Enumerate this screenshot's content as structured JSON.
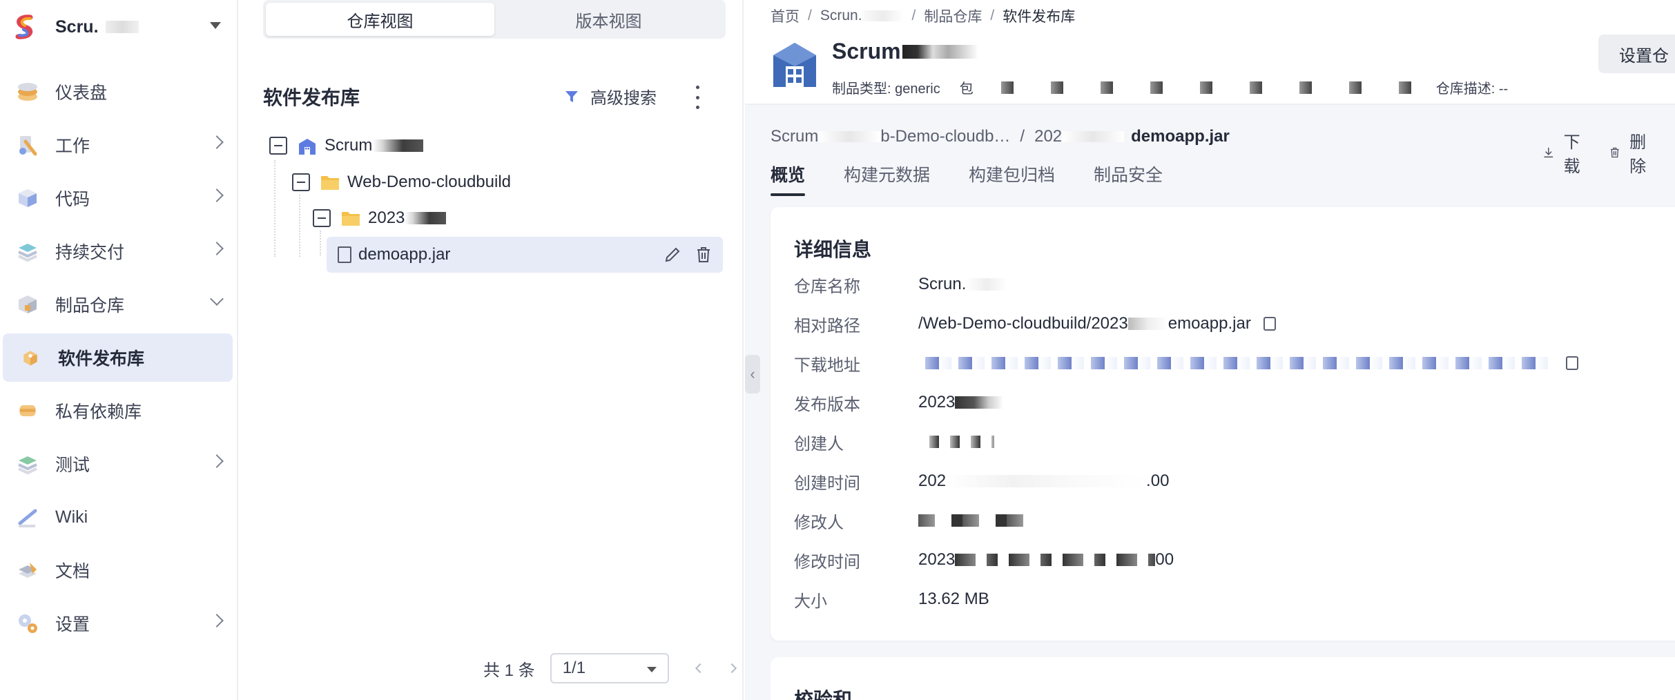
{
  "sidebar": {
    "brand": {
      "name": "Scru."
    },
    "items": [
      {
        "label": "仪表盘",
        "has_children": false,
        "icon": "dashboard-icon"
      },
      {
        "label": "工作",
        "has_children": true,
        "icon": "work-icon"
      },
      {
        "label": "代码",
        "has_children": true,
        "icon": "code-icon"
      },
      {
        "label": "持续交付",
        "has_children": true,
        "icon": "delivery-icon"
      },
      {
        "label": "制品仓库",
        "has_children": true,
        "expanded": true,
        "icon": "artifact-repo-icon"
      },
      {
        "label": "软件发布库",
        "active": true,
        "icon": "release-repo-icon"
      },
      {
        "label": "私有依赖库",
        "icon": "dependency-repo-icon"
      },
      {
        "label": "测试",
        "has_children": true,
        "icon": "test-icon"
      },
      {
        "label": "Wiki",
        "has_children": false,
        "icon": "wiki-icon"
      },
      {
        "label": "文档",
        "has_children": false,
        "icon": "docs-icon"
      },
      {
        "label": "设置",
        "has_children": true,
        "icon": "settings-icon"
      }
    ]
  },
  "tree_panel": {
    "view_tabs": [
      "仓库视图",
      "版本视图"
    ],
    "active_view": "仓库视图",
    "title": "软件发布库",
    "advanced_search": "高级搜索",
    "nodes": {
      "repo": "Scrum",
      "folder": "Web-Demo-cloudbuild",
      "version_folder": "2023",
      "file": "demoapp.jar"
    },
    "pager": {
      "total": "共 1 条",
      "page": "1/1"
    }
  },
  "detail": {
    "breadcrumb": [
      "首页",
      "Scrun.",
      "制品仓库",
      "软件发布库"
    ],
    "repo_name": "Scrum",
    "repo_type_label": "制品类型: generic",
    "repo_meta_prefix": "包",
    "repo_desc_label": "仓库描述: --",
    "settings_button": "设置仓",
    "path": {
      "part1": "Scrum",
      "part2": "b-Demo-cloudb…",
      "part3": "202",
      "file": "demoapp.jar"
    },
    "download_label": "下载",
    "delete_label": "删除",
    "tabs": [
      "概览",
      "构建元数据",
      "构建包归档",
      "制品安全"
    ],
    "active_tab": "概览",
    "info": {
      "heading": "详细信息",
      "rows": [
        {
          "key": "仓库名称",
          "value": "Scrun."
        },
        {
          "key": "相对路径",
          "value": "/Web-Demo-cloudbuild/2023\u0000emoapp.jar"
        },
        {
          "key": "下载地址",
          "value": ""
        },
        {
          "key": "发布版本",
          "value": "2023"
        },
        {
          "key": "创建人",
          "value": ""
        },
        {
          "key": "创建时间",
          "value": "202"
        },
        {
          "key": "修改人",
          "value": ""
        },
        {
          "key": "修改时间",
          "value": "2023"
        },
        {
          "key": "大小",
          "value": "13.62 MB"
        }
      ],
      "path_value_start": "/Web-Demo-cloudbuild/2023",
      "path_value_end": "emoapp.jar",
      "created_suffix": ".00",
      "modified_suffix": "00"
    },
    "checksum_heading": "校验和"
  }
}
